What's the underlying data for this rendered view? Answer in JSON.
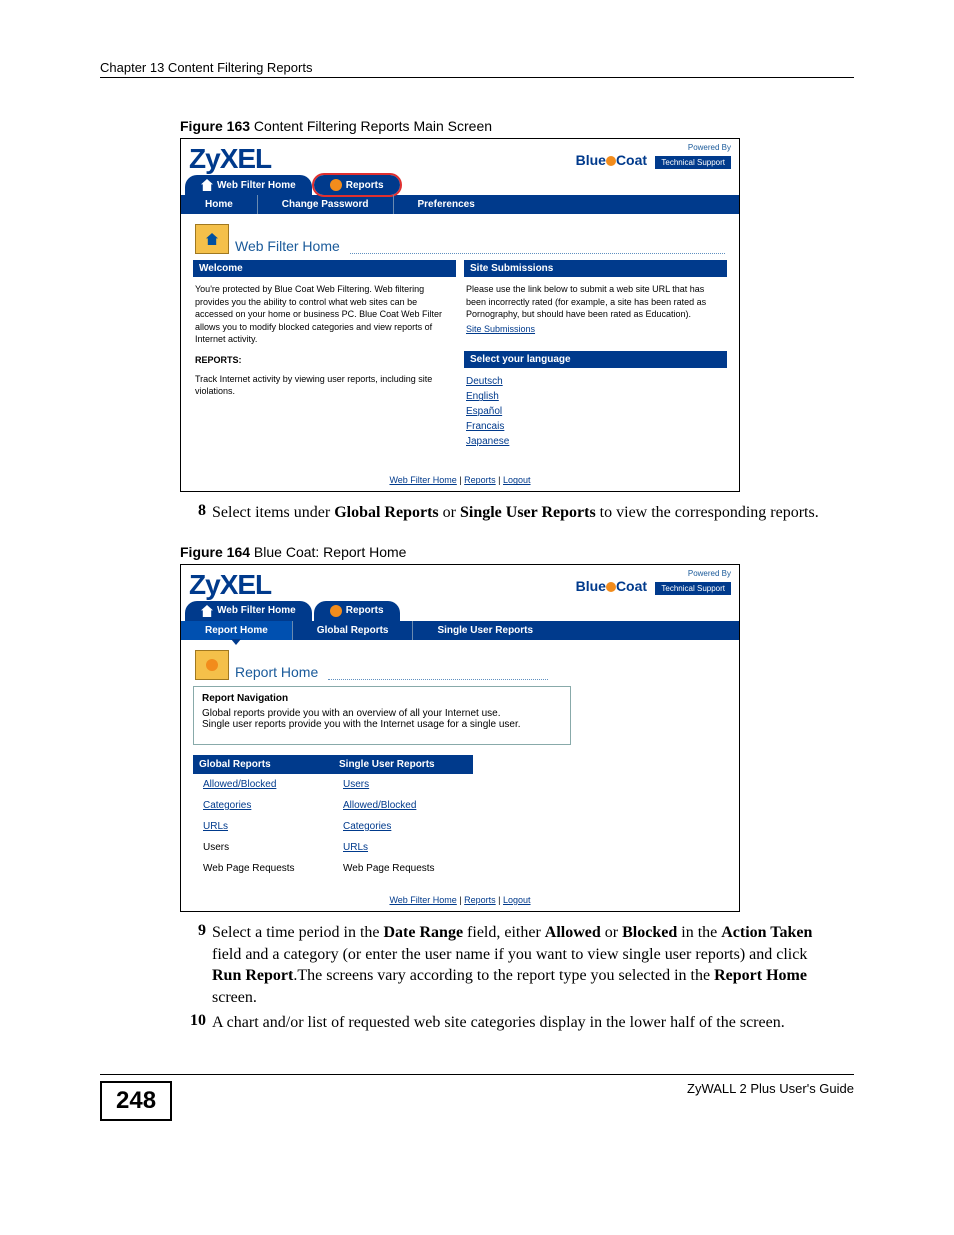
{
  "chapter_header": "Chapter 13 Content Filtering Reports",
  "page_number": "248",
  "guide_name": "ZyWALL 2 Plus User's Guide",
  "figure163": {
    "caption_bold": "Figure 163",
    "caption_rest": "   Content Filtering Reports Main Screen",
    "logo": "ZyXEL",
    "powered_by": "Powered By",
    "bluecoat_a": "Blue",
    "bluecoat_b": "Coat",
    "tech_support": "Technical Support",
    "tabs": {
      "home": "Web Filter Home",
      "reports": "Reports"
    },
    "nav": {
      "home": "Home",
      "change_password": "Change Password",
      "preferences": "Preferences"
    },
    "page_title": "Web Filter Home",
    "welcome_header": "Welcome",
    "welcome_text": "You're protected by Blue Coat Web Filtering.  Web filtering provides you the ability to control what web sites can be accessed on your home or business PC.  Blue Coat Web Filter allows you to modify blocked categories and view reports of Internet activity.",
    "reports_label": "REPORTS:",
    "reports_text": "Track Internet activity by viewing user reports, including site violations.",
    "submissions_header": "Site Submissions",
    "submissions_text": "Please use the link below to submit a web site URL that has been incorrectly rated (for example, a site has been rated as Pornography, but should have been rated as Education).",
    "submissions_link": "Site Submissions",
    "lang_header": "Select your language",
    "languages": [
      "Deutsch",
      "English",
      "Español",
      "Francais",
      "Japanese"
    ],
    "footer": {
      "a": "Web Filter Home",
      "b": "Reports",
      "c": "Logout"
    }
  },
  "step8": {
    "num": "8",
    "pre": "Select items under ",
    "b1": "Global Reports",
    "mid": " or ",
    "b2": "Single User Reports",
    "post": " to view the corresponding reports."
  },
  "figure164": {
    "caption_bold": "Figure 164",
    "caption_rest": "   Blue Coat: Report Home",
    "logo": "ZyXEL",
    "powered_by": "Powered By",
    "bluecoat_a": "Blue",
    "bluecoat_b": "Coat",
    "tech_support": "Technical Support",
    "tabs": {
      "home": "Web Filter Home",
      "reports": "Reports"
    },
    "nav": {
      "report_home": "Report Home",
      "global": "Global Reports",
      "single": "Single User Reports"
    },
    "page_title": "Report Home",
    "nav_box_title": "Report Navigation",
    "nav_box_text1": "Global reports provide you with an overview of all your Internet use.",
    "nav_box_text2": "Single user reports provide you with the Internet usage for a single user.",
    "global_header": "Global Reports",
    "single_header": "Single User Reports",
    "global_rows": [
      "Allowed/Blocked",
      "Categories",
      "URLs",
      "Users",
      "Web Page Requests"
    ],
    "single_rows": [
      "Users",
      "Allowed/Blocked",
      "Categories",
      "URLs",
      "Web Page Requests"
    ],
    "footer": {
      "a": "Web Filter Home",
      "b": "Reports",
      "c": "Logout"
    }
  },
  "step9": {
    "num": "9",
    "t1": "Select a time period in the ",
    "b1": "Date Range",
    "t2": " field, either ",
    "b2": "Allowed",
    "t3": " or ",
    "b3": "Blocked",
    "t4": " in the ",
    "b4": "Action Taken",
    "t5": " field and a category (or enter the user name if you want to view single user reports) and click ",
    "b5": "Run Report",
    "t6": ".The screens vary according to the report type you selected in the ",
    "b6": "Report Home",
    "t7": " screen."
  },
  "step10": {
    "num": "10",
    "text": "A chart and/or list of requested web site categories display in the lower half of the screen."
  }
}
